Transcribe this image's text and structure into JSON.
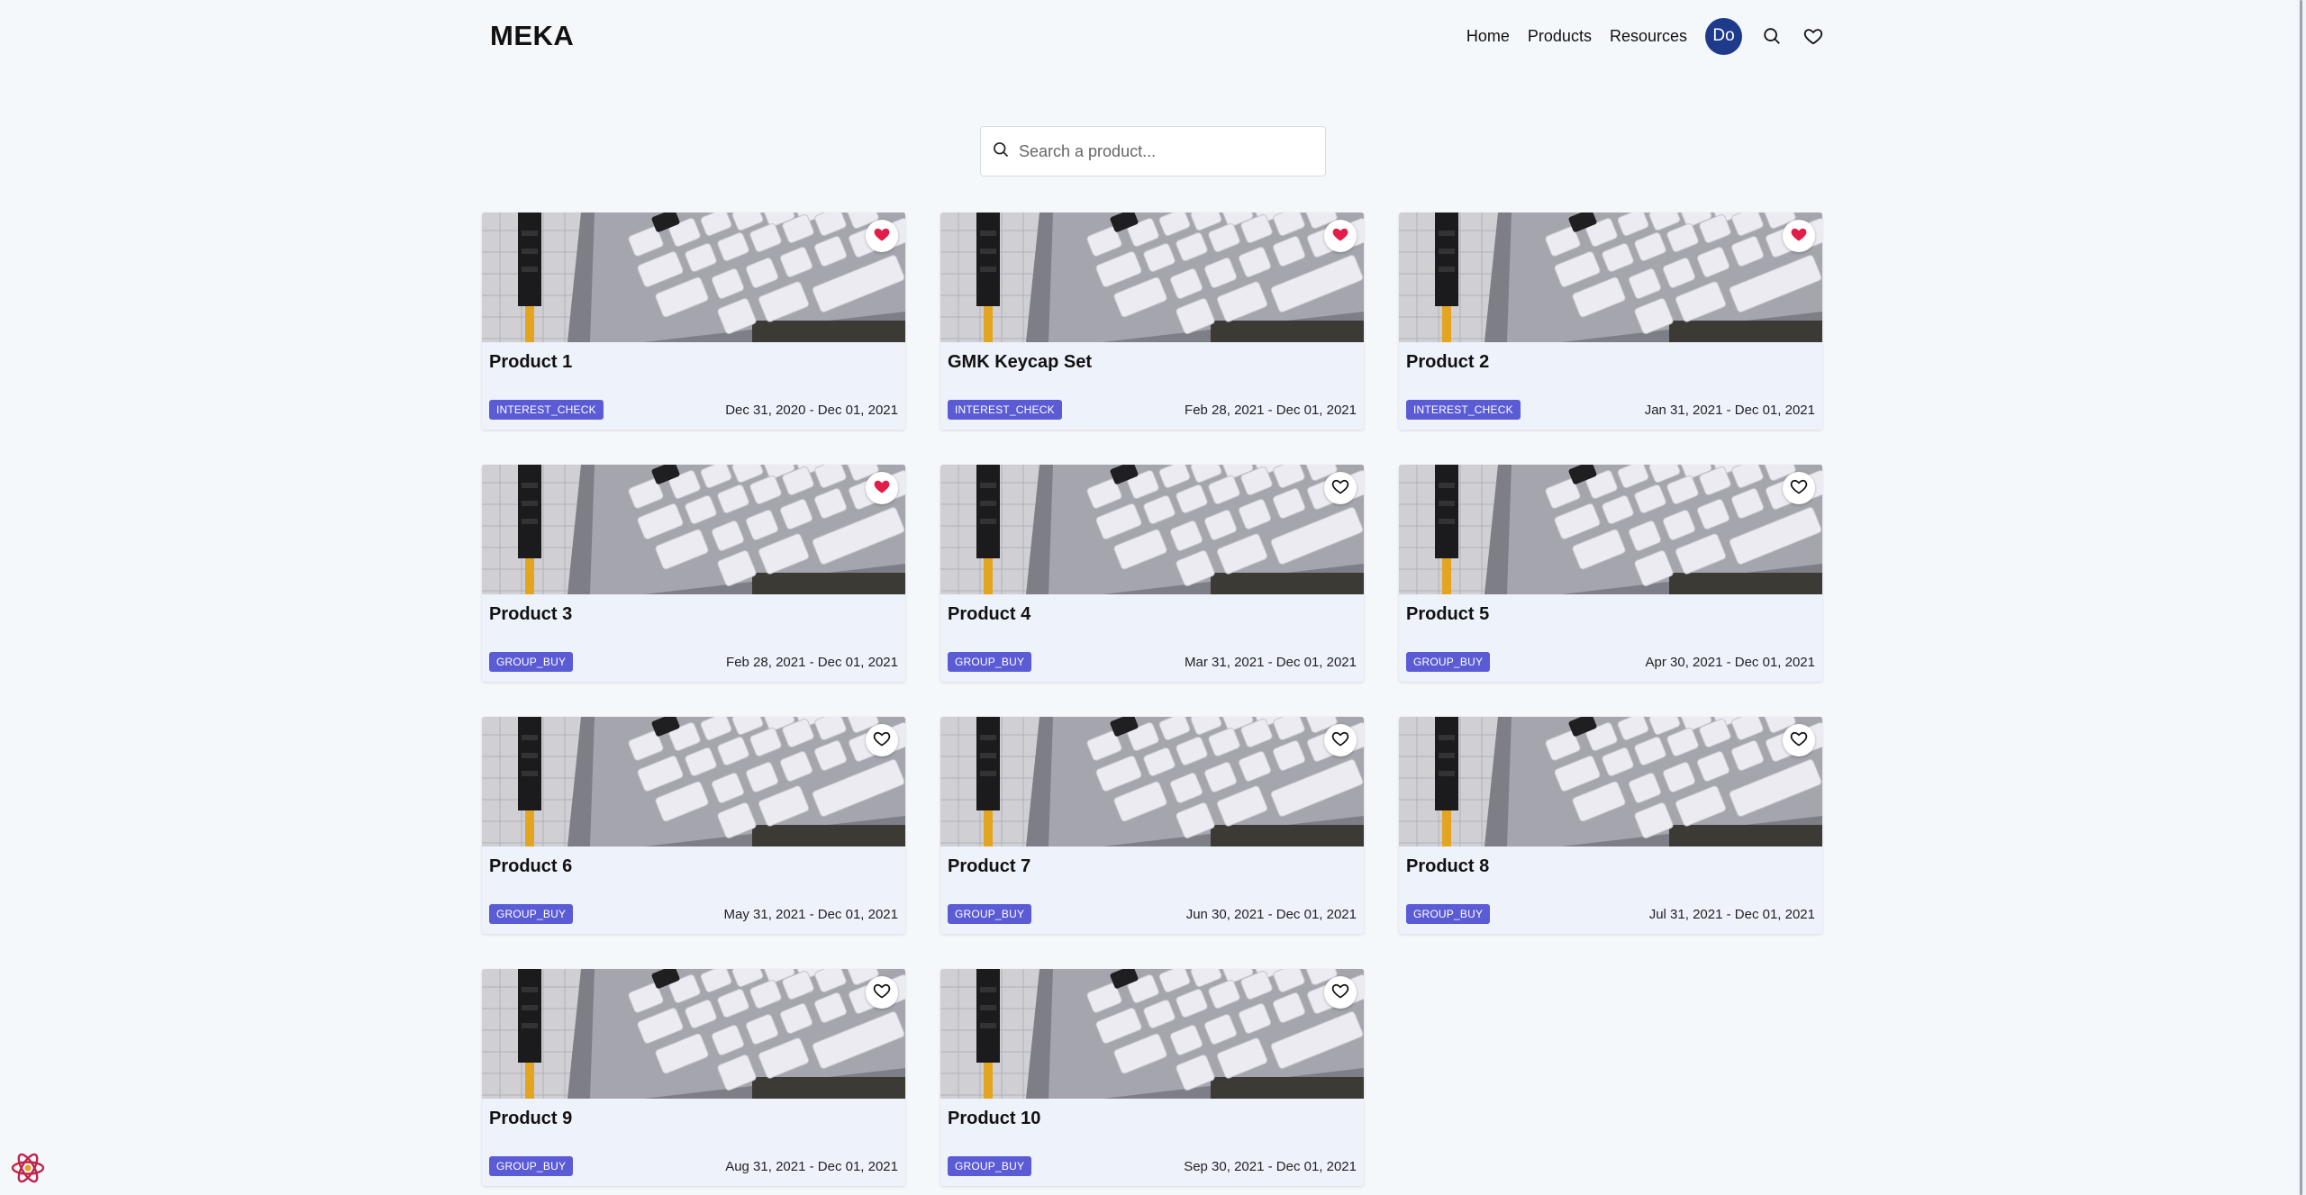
{
  "header": {
    "logo": "MEKA",
    "nav": [
      "Home",
      "Products",
      "Resources"
    ],
    "avatar_initials": "Do"
  },
  "search": {
    "placeholder": "Search a product..."
  },
  "colors": {
    "badge": "#5b5bd6",
    "avatar": "#1e3a8a",
    "heart_active": "#e11d48",
    "background": "#f5f8fb"
  },
  "products": [
    {
      "title": "Product 1",
      "status": "INTEREST_CHECK",
      "dates": "Dec 31, 2020 - Dec 01, 2021",
      "favorited": true
    },
    {
      "title": "GMK Keycap Set",
      "status": "INTEREST_CHECK",
      "dates": "Feb 28, 2021 - Dec 01, 2021",
      "favorited": true
    },
    {
      "title": "Product 2",
      "status": "INTEREST_CHECK",
      "dates": "Jan 31, 2021 - Dec 01, 2021",
      "favorited": true
    },
    {
      "title": "Product 3",
      "status": "GROUP_BUY",
      "dates": "Feb 28, 2021 - Dec 01, 2021",
      "favorited": true
    },
    {
      "title": "Product 4",
      "status": "GROUP_BUY",
      "dates": "Mar 31, 2021 - Dec 01, 2021",
      "favorited": false
    },
    {
      "title": "Product 5",
      "status": "GROUP_BUY",
      "dates": "Apr 30, 2021 - Dec 01, 2021",
      "favorited": false
    },
    {
      "title": "Product 6",
      "status": "GROUP_BUY",
      "dates": "May 31, 2021 - Dec 01, 2021",
      "favorited": false
    },
    {
      "title": "Product 7",
      "status": "GROUP_BUY",
      "dates": "Jun 30, 2021 - Dec 01, 2021",
      "favorited": false
    },
    {
      "title": "Product 8",
      "status": "GROUP_BUY",
      "dates": "Jul 31, 2021 - Dec 01, 2021",
      "favorited": false
    },
    {
      "title": "Product 9",
      "status": "GROUP_BUY",
      "dates": "Aug 31, 2021 - Dec 01, 2021",
      "favorited": false
    },
    {
      "title": "Product 10",
      "status": "GROUP_BUY",
      "dates": "Sep 30, 2021 - Dec 01, 2021",
      "favorited": false
    }
  ]
}
